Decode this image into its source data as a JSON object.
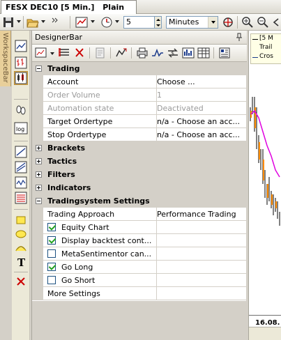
{
  "window": {
    "tab_title": "FESX DEC10 [5 Min.]",
    "tab_mode": "Plain"
  },
  "toolbar": {
    "interval_value": "5",
    "interval_unit": "Minutes"
  },
  "workspace_bar": {
    "label": "WorkspaceBar"
  },
  "designer": {
    "title": "DesignerBar",
    "sections": {
      "trading": {
        "label": "Trading",
        "account": {
          "name": "Account",
          "value": "Choose ..."
        },
        "order_volume": {
          "name": "Order Volume",
          "value": "1"
        },
        "automation_state": {
          "name": "Automation state",
          "value": "Deactivated"
        },
        "target_ordertype": {
          "name": "Target Ordertype",
          "value": "n/a - Choose an acc..."
        },
        "stop_ordertype": {
          "name": "Stop Ordertype",
          "value": "n/a - Choose an acc..."
        }
      },
      "brackets": {
        "label": "Brackets"
      },
      "tactics": {
        "label": "Tactics"
      },
      "filters": {
        "label": "Filters"
      },
      "indicators": {
        "label": "Indicators"
      },
      "tradingsystem": {
        "label": "Tradingsystem Settings",
        "trading_approach": {
          "name": "Trading Approach",
          "value": "Performance Trading"
        },
        "equity_chart": {
          "name": "Equity Chart",
          "checked": true
        },
        "display_backtest": {
          "name": "Display backtest cont...",
          "checked": true
        },
        "metasentimentor": {
          "name": "MetaSentimentor can...",
          "checked": false
        },
        "go_long": {
          "name": "Go Long",
          "checked": true
        },
        "go_short": {
          "name": "Go Short",
          "checked": false
        },
        "more_settings": {
          "name": "More Settings"
        }
      }
    }
  },
  "chart": {
    "legend": [
      "[5 M",
      "Trail",
      "Cros"
    ],
    "date_label": "16.08."
  },
  "colors": {
    "workspace_bar": "#e8cf9a",
    "category_bg": "#d4d0c8",
    "disabled_text": "#9a9a9a",
    "check_green": "#21a121",
    "chart_magenta": "#e000e0",
    "chart_orange": "#ff8c00"
  }
}
